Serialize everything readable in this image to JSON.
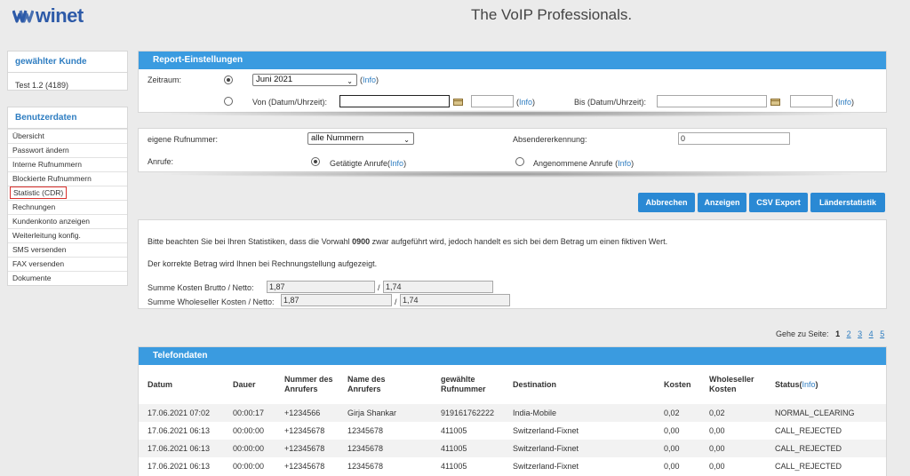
{
  "header": {
    "logo_text": "winet",
    "tagline": "The VoIP Professionals."
  },
  "sidebar": {
    "customer_title": "gewählter Kunde",
    "customer_value": "Test 1.2 (4189)",
    "user_title": "Benutzerdaten",
    "items": [
      {
        "label": "Übersicht"
      },
      {
        "label": "Passwort ändern"
      },
      {
        "label": "Interne Rufnummern"
      },
      {
        "label": "Blockierte Rufnummern"
      },
      {
        "label": "Statistic (CDR)"
      },
      {
        "label": "Rechnungen"
      },
      {
        "label": "Kundenkonto anzeigen"
      },
      {
        "label": "Weiterleitung konfig."
      },
      {
        "label": "SMS versenden"
      },
      {
        "label": "FAX versenden"
      },
      {
        "label": "Dokumente"
      }
    ]
  },
  "report": {
    "title": "Report-Einstellungen",
    "zeitraum_label": "Zeitraum:",
    "month_value": "Juni 2021",
    "info": "Info",
    "from_label": "Von (Datum/Uhrzeit):",
    "to_label": "Bis (Datum/Uhrzeit):"
  },
  "filters": {
    "own_number_label": "eigene Rufnummer:",
    "own_number_value": "alle Nummern",
    "sender_label": "Absendererkennung:",
    "sender_value": "0",
    "calls_label": "Anrufe:",
    "outgoing_label": "Getätigte Anrufe",
    "incoming_label": "Angenommene Anrufe",
    "info": "Info"
  },
  "buttons": {
    "cancel": "Abbrechen",
    "show": "Anzeigen",
    "csv": "CSV Export",
    "country": "Länderstatistik"
  },
  "notice": {
    "line1_a": "Bitte beachten Sie bei Ihren Statistiken, dass die Vorwahl ",
    "line1_b": "0900",
    "line1_c": " zwar aufgeführt wird, jedoch handelt es sich bei dem Betrag um einen fiktiven Wert.",
    "line2": "Der korrekte Betrag wird Ihnen bei Rechnungstellung aufgezeigt.",
    "sum_label": "Summe Kosten Brutto / Netto:",
    "sum_brutto": "1,87",
    "sum_netto": "1,74",
    "wholesale_label": "Summe Wholeseller Kosten / Netto:",
    "wholesale_brutto": "1,87",
    "wholesale_netto": "1,74",
    "slash": "/"
  },
  "pager": {
    "label": "Gehe zu Seite:",
    "pages": [
      "1",
      "2",
      "3",
      "4",
      "5"
    ]
  },
  "phone": {
    "title": "Telefondaten",
    "columns": {
      "datum": "Datum",
      "dauer": "Dauer",
      "nummer": "Nummer des Anrufers",
      "name": "Name des Anrufers",
      "gewaehlte": "gewählte Rufnummer",
      "destination": "Destination",
      "kosten": "Kosten",
      "wholeseller": "Wholeseller Kosten",
      "status": "Status(",
      "status_info": "Info",
      "status_close": ")"
    },
    "rows": [
      {
        "datum": "17.06.2021 07:02",
        "dauer": "00:00:17",
        "nummer": "+1234566",
        "name": "Girja Shankar",
        "gewaehlte": "919161762222",
        "destination": "India-Mobile",
        "kosten": "0,02",
        "wholeseller": "0,02",
        "status": "NORMAL_CLEARING"
      },
      {
        "datum": "17.06.2021 06:13",
        "dauer": "00:00:00",
        "nummer": "+12345678",
        "name": "12345678",
        "gewaehlte": "411005",
        "destination": "Switzerland-Fixnet",
        "kosten": "0,00",
        "wholeseller": "0,00",
        "status": "CALL_REJECTED"
      },
      {
        "datum": "17.06.2021 06:13",
        "dauer": "00:00:00",
        "nummer": "+12345678",
        "name": "12345678",
        "gewaehlte": "411005",
        "destination": "Switzerland-Fixnet",
        "kosten": "0,00",
        "wholeseller": "0,00",
        "status": "CALL_REJECTED"
      },
      {
        "datum": "17.06.2021 06:13",
        "dauer": "00:00:00",
        "nummer": "+12345678",
        "name": "12345678",
        "gewaehlte": "411005",
        "destination": "Switzerland-Fixnet",
        "kosten": "0,00",
        "wholeseller": "0,00",
        "status": "CALL_REJECTED"
      }
    ]
  }
}
